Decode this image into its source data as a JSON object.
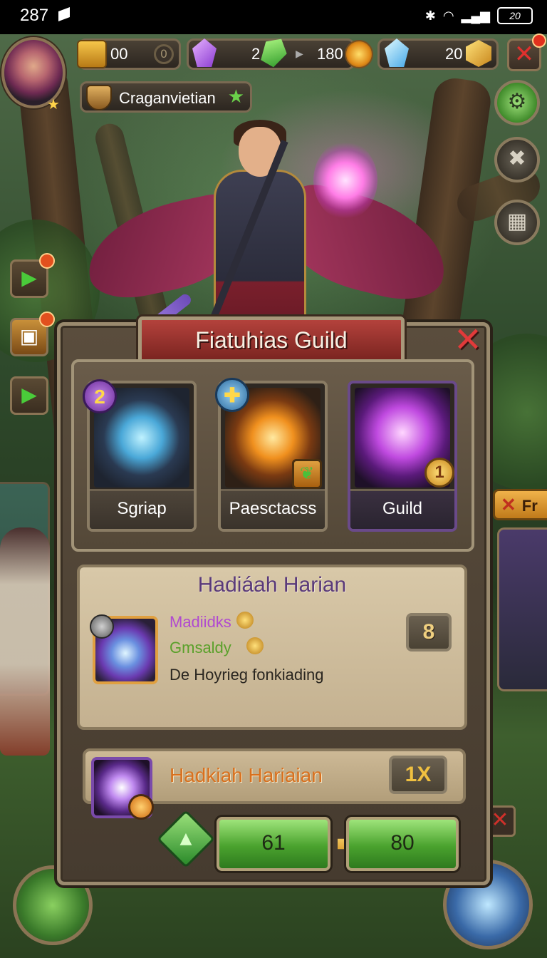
{
  "status_bar": {
    "time": "287",
    "battery": "20"
  },
  "hud": {
    "gold": "00",
    "gold_extra": "0",
    "purple": "2",
    "green": "180",
    "blue": "20",
    "player_name": "Craganvietian"
  },
  "panel": {
    "title": "Fiatuhias Guild",
    "tabs": [
      {
        "label": "Sgriap",
        "badge": "2"
      },
      {
        "label": "Paesctacss",
        "badge": ""
      },
      {
        "label": "Guild",
        "badge": "1"
      }
    ],
    "reward": {
      "title": "Hadiáah Harian",
      "line1": "Madiidks",
      "line2": "Gmsaldy",
      "line3": "De Hoyrieg fonkiading",
      "count": "8"
    },
    "second": {
      "label": "Hadkiah Hariaian",
      "count": "1X"
    },
    "buttons": {
      "left": "61",
      "right": "80"
    }
  },
  "side": {
    "right_tag": "Fr"
  },
  "icons": [
    "gold-chest-icon",
    "purple-gem-icon",
    "green-gem-icon",
    "fire-coin-icon",
    "blue-gem-icon",
    "gold-cube-icon",
    "close-icon",
    "guild-shield-icon",
    "star-icon",
    "gear-icon",
    "crossed-swords-icon",
    "map-icon",
    "play-icon",
    "chest-icon"
  ],
  "colors": {
    "banner_red": "#b4423c",
    "button_green": "#4aa22e",
    "reward_purple_text": "#5a3a7a",
    "accent_gold": "#f0c040"
  }
}
